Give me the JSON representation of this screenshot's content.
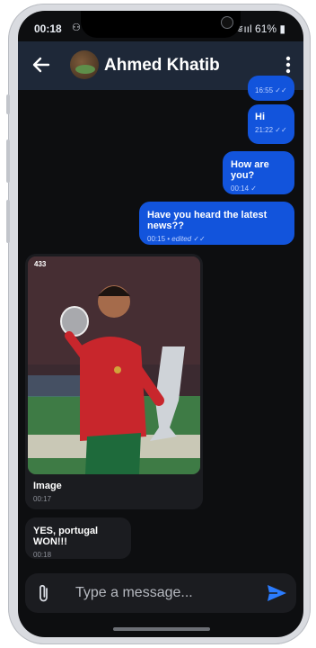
{
  "status": {
    "time": "00:18",
    "battery": "61%"
  },
  "header": {
    "contact_name": "Ahmed Khatib"
  },
  "messages": [
    {
      "text": "",
      "time": "16:55"
    },
    {
      "text": "Hi",
      "time": "21:22"
    },
    {
      "text": "How are you?",
      "time": "00:14"
    },
    {
      "text": "Have you heard the latest news??",
      "time": "00:15",
      "edited": "• edited"
    },
    {
      "text": "Image",
      "time": "00:17"
    },
    {
      "text": "YES, portugal WON!!!",
      "time": "00:18"
    }
  ],
  "image_watermark": "433",
  "composer": {
    "placeholder": "Type a message..."
  }
}
